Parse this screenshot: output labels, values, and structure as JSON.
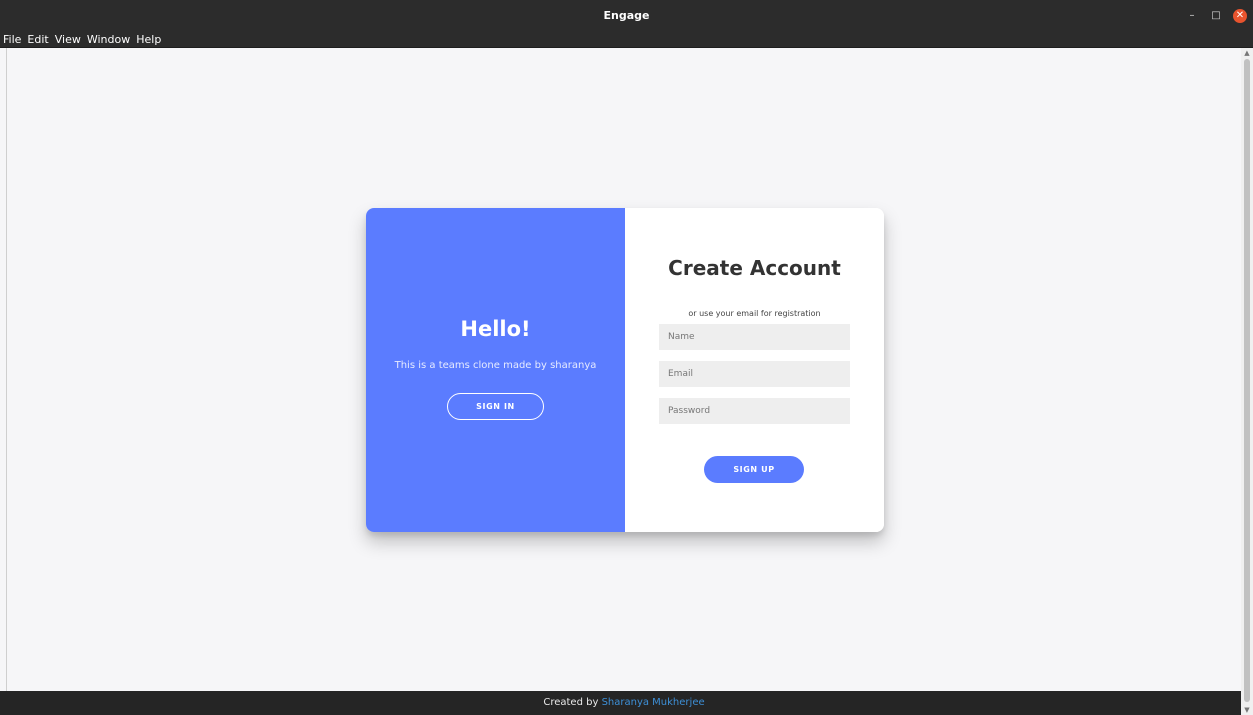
{
  "window": {
    "title": "Engage",
    "controls": {
      "minimize": "–",
      "maximize": "□",
      "close": "✕"
    }
  },
  "menu": {
    "items": [
      "File",
      "Edit",
      "View",
      "Window",
      "Help"
    ]
  },
  "left_panel": {
    "heading": "Hello!",
    "subtitle": "This is a teams clone made by sharanya",
    "button_label": "SIGN IN"
  },
  "right_panel": {
    "heading": "Create Account",
    "note": "or use your email for registration",
    "fields": {
      "name": {
        "placeholder": "Name",
        "value": ""
      },
      "email": {
        "placeholder": "Email",
        "value": ""
      },
      "password": {
        "placeholder": "Password",
        "value": ""
      }
    },
    "button_label": "SIGN UP"
  },
  "footer": {
    "prefix": "Created by ",
    "author": "Sharanya Mukherjee"
  },
  "colors": {
    "accent": "#5b7cff",
    "titlebar": "#2c2c2c",
    "footer": "#252525",
    "link": "#3d8fd6",
    "close_button": "#e9542e"
  },
  "icons": {
    "minimize": "minimize-icon",
    "maximize": "maximize-icon",
    "close": "close-icon",
    "scroll_up": "scroll-up-arrow-icon",
    "scroll_down": "scroll-down-arrow-icon"
  }
}
